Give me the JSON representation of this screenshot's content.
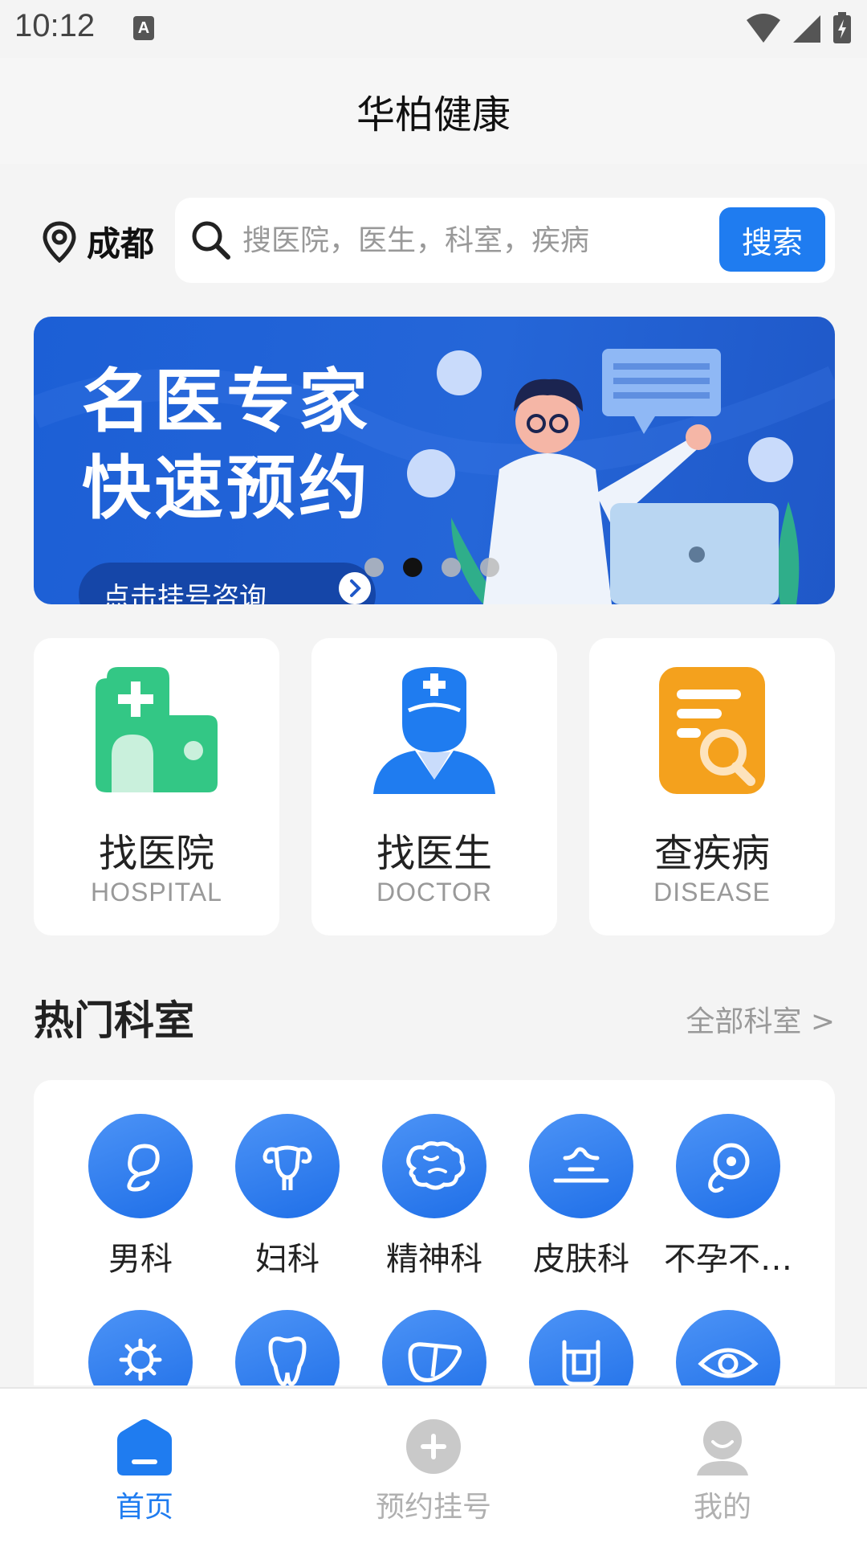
{
  "status_bar": {
    "time": "10:12",
    "notification_glyph": "A"
  },
  "header": {
    "title": "华柏健康"
  },
  "search": {
    "city": "成都",
    "placeholder": "搜医院，医生，科室，疾病",
    "button_label": "搜索"
  },
  "banner": {
    "headline_line1": "名医专家",
    "headline_line2": "快速预约",
    "cta_label": "点击挂号咨询",
    "dots_count": 4,
    "active_dot": 1
  },
  "quick_cards": [
    {
      "title": "找医院",
      "subtitle": "HOSPITAL",
      "icon": "hospital-icon",
      "color": "#33c785"
    },
    {
      "title": "找医生",
      "subtitle": "DOCTOR",
      "icon": "doctor-icon",
      "color": "#1f7cf0"
    },
    {
      "title": "查疾病",
      "subtitle": "DISEASE",
      "icon": "disease-search-icon",
      "color": "#f4a11d"
    }
  ],
  "departments_section": {
    "title": "热门科室",
    "all_link": "全部科室 >"
  },
  "departments": [
    {
      "label": "男科",
      "icon": "male-icon"
    },
    {
      "label": "妇科",
      "icon": "uterus-icon"
    },
    {
      "label": "精神科",
      "icon": "brain-icon"
    },
    {
      "label": "皮肤科",
      "icon": "skin-icon"
    },
    {
      "label": "不孕不…",
      "icon": "embryo-icon"
    },
    {
      "label": "",
      "icon": "virus-icon"
    },
    {
      "label": "",
      "icon": "tooth-icon"
    },
    {
      "label": "",
      "icon": "liver-icon"
    },
    {
      "label": "",
      "icon": "intestine-icon"
    },
    {
      "label": "",
      "icon": "eye-icon"
    }
  ],
  "bottom_nav": [
    {
      "label": "首页",
      "icon": "home-icon",
      "active": true
    },
    {
      "label": "预约挂号",
      "icon": "plus-circle-icon",
      "active": false
    },
    {
      "label": "我的",
      "icon": "user-icon",
      "active": false
    }
  ],
  "colors": {
    "accent": "#1f7cf0",
    "inactive": "#b0b0b0"
  }
}
